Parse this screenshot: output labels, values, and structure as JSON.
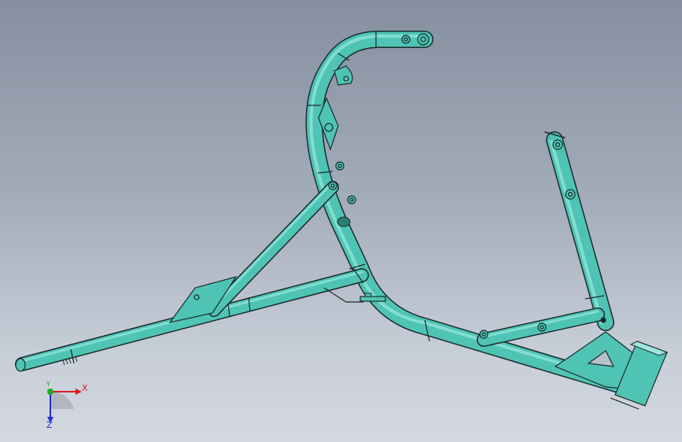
{
  "viewport": {
    "background_top": "#858f9f",
    "background_bottom": "#d3d8e0"
  },
  "model": {
    "part_color": "#4fc4b4",
    "edge_color": "#1a2b2a",
    "highlight_color": "#9fe6dc"
  },
  "triad": {
    "x_label": "X",
    "y_label": "Y",
    "z_label": "Z",
    "x_color": "#d81e1e",
    "y_color": "#1fa81f",
    "z_color": "#1f2fd0"
  }
}
